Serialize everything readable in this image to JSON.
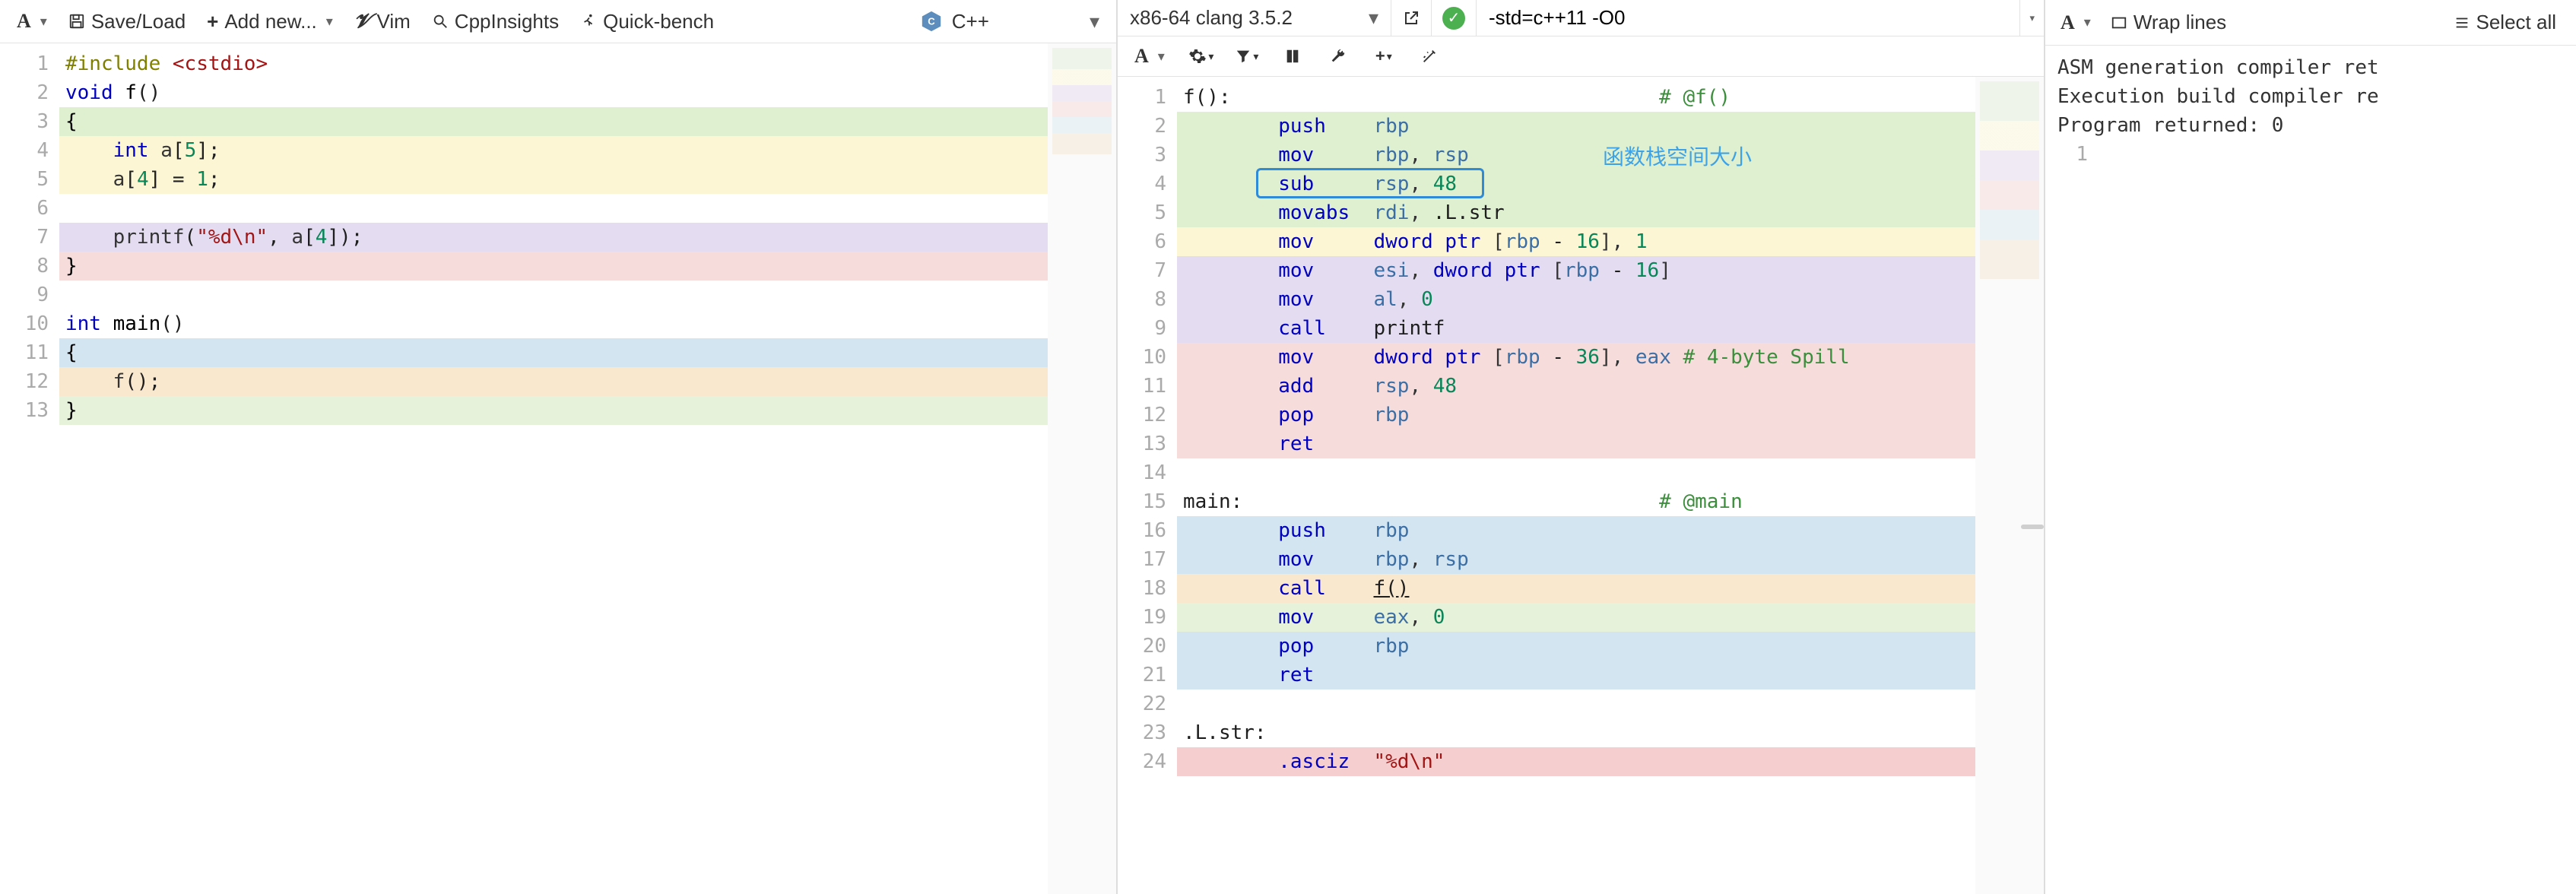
{
  "topbar": {
    "save_load": "Save/Load",
    "add_new": "Add new...",
    "vim": "Vim",
    "cppinsights": "CppInsights",
    "quickbench": "Quick-bench",
    "language": "C++"
  },
  "compiler": {
    "name": "x86-64 clang 3.5.2",
    "options": "-std=c++11 -O0",
    "status": "ok"
  },
  "output_toolbar": {
    "wrap": "Wrap lines",
    "select_all": "Select all"
  },
  "source": {
    "lines": [
      {
        "n": 1,
        "bg": "",
        "html": "<span class='pp'>#include</span> <span class='str'>&lt;cstdio&gt;</span>"
      },
      {
        "n": 2,
        "bg": "",
        "html": "<span class='kw'>void</span> <span class='fn'>f</span><span class='op'>()</span>"
      },
      {
        "n": 3,
        "bg": "bg-green",
        "html": "<span class='brace'>{</span>"
      },
      {
        "n": 4,
        "bg": "bg-yellow",
        "html": "    <span class='kw'>int</span> a<span class='op'>[</span><span class='num'>5</span><span class='op'>];</span>"
      },
      {
        "n": 5,
        "bg": "bg-yellow",
        "html": "    a<span class='op'>[</span><span class='num'>4</span><span class='op'>]</span> <span class='op'>=</span> <span class='num'>1</span><span class='op'>;</span>"
      },
      {
        "n": 6,
        "bg": "",
        "html": ""
      },
      {
        "n": 7,
        "bg": "bg-purple",
        "html": "    printf<span class='op'>(</span><span class='str'>\"%d\\n\"</span><span class='op'>,</span> a<span class='op'>[</span><span class='num'>4</span><span class='op'>]);</span>"
      },
      {
        "n": 8,
        "bg": "bg-pink",
        "html": "<span class='brace'>}</span>"
      },
      {
        "n": 9,
        "bg": "",
        "html": ""
      },
      {
        "n": 10,
        "bg": "",
        "html": "<span class='kw'>int</span> <span class='fn'>main</span><span class='op'>()</span>"
      },
      {
        "n": 11,
        "bg": "bg-blue",
        "html": "<span class='brace'>{</span>"
      },
      {
        "n": 12,
        "bg": "bg-orange",
        "html": "    f<span class='op'>();</span>"
      },
      {
        "n": 13,
        "bg": "bg-ltgreen",
        "html": "<span class='brace'>}</span>"
      }
    ]
  },
  "asm": {
    "annotation": "函数栈空间大小",
    "lines": [
      {
        "n": 1,
        "bg": "",
        "html": "<span class='label'>f():</span>                                    <span class='cmt'># @f()</span>"
      },
      {
        "n": 2,
        "bg": "bg-green",
        "html": "        <span class='mnem'>push</span>    <span class='reg'>rbp</span>"
      },
      {
        "n": 3,
        "bg": "bg-green",
        "html": "        <span class='mnem'>mov</span>     <span class='reg'>rbp</span>, <span class='reg'>rsp</span>"
      },
      {
        "n": 4,
        "bg": "bg-green",
        "html": "        <span class='mnem'>sub</span>     <span class='reg'>rsp</span>, <span class='asmnum'>48</span>"
      },
      {
        "n": 5,
        "bg": "bg-green",
        "html": "        <span class='mnem'>movabs</span>  <span class='reg'>rdi</span>, <span class='label'>.L.str</span>"
      },
      {
        "n": 6,
        "bg": "bg-yellow",
        "html": "        <span class='mnem'>mov</span>     <span class='kw'>dword ptr</span> [<span class='reg'>rbp</span> <span class='op'>-</span> <span class='asmnum'>16</span>], <span class='asmnum'>1</span>"
      },
      {
        "n": 7,
        "bg": "bg-purple",
        "html": "        <span class='mnem'>mov</span>     <span class='reg'>esi</span>, <span class='kw'>dword ptr</span> [<span class='reg'>rbp</span> <span class='op'>-</span> <span class='asmnum'>16</span>]"
      },
      {
        "n": 8,
        "bg": "bg-purple",
        "html": "        <span class='mnem'>mov</span>     <span class='reg'>al</span>, <span class='asmnum'>0</span>"
      },
      {
        "n": 9,
        "bg": "bg-purple",
        "html": "        <span class='mnem'>call</span>    <span class='label'>printf</span>"
      },
      {
        "n": 10,
        "bg": "bg-pink",
        "html": "        <span class='mnem'>mov</span>     <span class='kw'>dword ptr</span> [<span class='reg'>rbp</span> <span class='op'>-</span> <span class='asmnum'>36</span>], <span class='reg'>eax</span> <span class='cmt'># 4-byte Spill</span>"
      },
      {
        "n": 11,
        "bg": "bg-pink",
        "html": "        <span class='mnem'>add</span>     <span class='reg'>rsp</span>, <span class='asmnum'>48</span>"
      },
      {
        "n": 12,
        "bg": "bg-pink",
        "html": "        <span class='mnem'>pop</span>     <span class='reg'>rbp</span>"
      },
      {
        "n": 13,
        "bg": "bg-pink",
        "html": "        <span class='mnem'>ret</span>"
      },
      {
        "n": 14,
        "bg": "",
        "html": ""
      },
      {
        "n": 15,
        "bg": "",
        "html": "<span class='label'>main:</span>                                   <span class='cmt'># @main</span>"
      },
      {
        "n": 16,
        "bg": "bg-blue",
        "html": "        <span class='mnem'>push</span>    <span class='reg'>rbp</span>"
      },
      {
        "n": 17,
        "bg": "bg-blue",
        "html": "        <span class='mnem'>mov</span>     <span class='reg'>rbp</span>, <span class='reg'>rsp</span>"
      },
      {
        "n": 18,
        "bg": "bg-orange",
        "html": "        <span class='mnem'>call</span>    <span class='label link'>f()</span>"
      },
      {
        "n": 19,
        "bg": "bg-ltgreen",
        "html": "        <span class='mnem'>mov</span>     <span class='reg'>eax</span>, <span class='asmnum'>0</span>"
      },
      {
        "n": 20,
        "bg": "bg-blue",
        "html": "        <span class='mnem'>pop</span>     <span class='reg'>rbp</span>"
      },
      {
        "n": 21,
        "bg": "bg-blue",
        "html": "        <span class='mnem'>ret</span>"
      },
      {
        "n": 22,
        "bg": "",
        "html": ""
      },
      {
        "n": 23,
        "bg": "",
        "html": "<span class='label'>.L.str:</span>"
      },
      {
        "n": 24,
        "bg": "bg-red",
        "html": "        <span class='mnem'>.asciz</span>  <span class='str'>\"%d\\n\"</span>"
      }
    ]
  },
  "output": {
    "lines": [
      "ASM generation compiler ret",
      "Execution build compiler re",
      "Program returned: 0"
    ],
    "result_line_no": "1"
  }
}
